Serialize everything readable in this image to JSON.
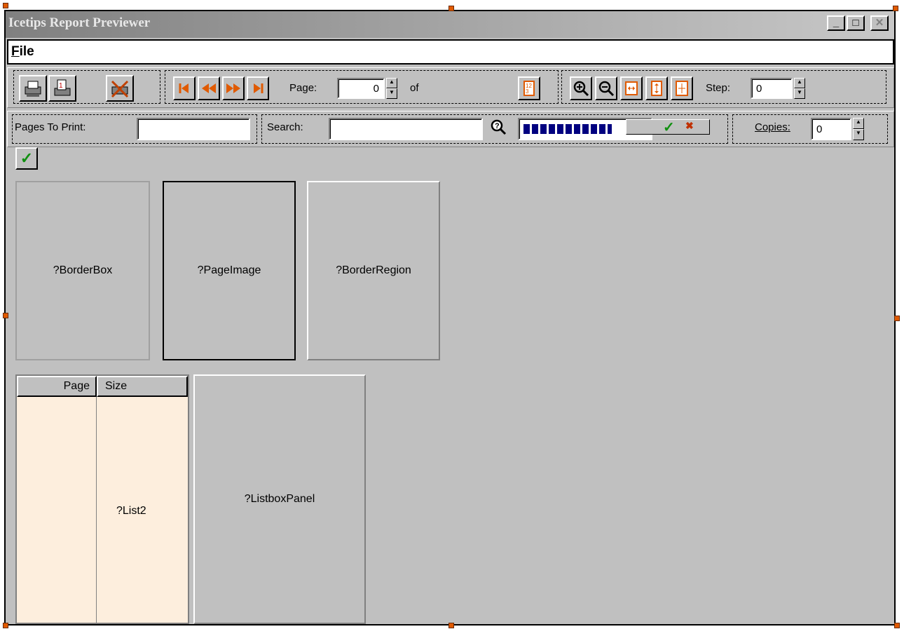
{
  "window": {
    "title": "Icetips Report Previewer",
    "controls": [
      "_",
      "□",
      "✕"
    ]
  },
  "menu": {
    "file_label": "File",
    "file_mnemonic": "F",
    "file_rest": "ile"
  },
  "toolbar1": {
    "page_label": "Page:",
    "page_value": "0",
    "of_label": "of",
    "step_label": "Step:",
    "step_value": "0"
  },
  "toolbar2": {
    "pages_to_print_label": "Pages To Print:",
    "pages_to_print_value": "",
    "search_label": "Search:",
    "search_value": "",
    "copies_label": "Copies:",
    "copies_value": "0",
    "progress": 0.7
  },
  "panels": {
    "border_box": "?BorderBox",
    "page_image": "?PageImage",
    "border_region": "?BorderRegion",
    "listbox_panel": "?ListboxPanel"
  },
  "list": {
    "columns": [
      "Page",
      "Size"
    ],
    "label": "?List2"
  },
  "colors": {
    "list_bg": "#fdeedd",
    "progress": "#000080",
    "handle": "#e05a00"
  }
}
